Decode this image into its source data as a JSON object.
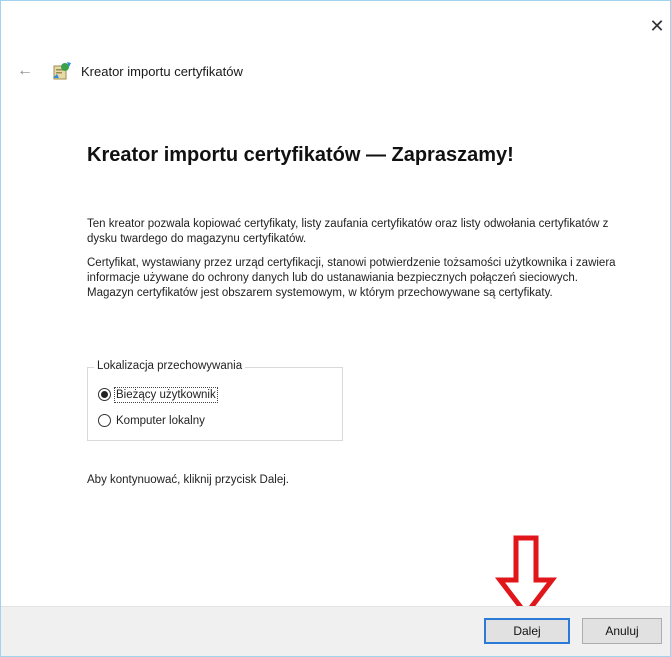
{
  "window": {
    "close_glyph": "✕"
  },
  "header": {
    "back_icon": "back-arrow-icon",
    "wizard_icon": "certificate-wizard-icon",
    "title": "Kreator importu certyfikatów"
  },
  "main": {
    "heading": "Kreator importu certyfikatów — Zapraszamy!",
    "paragraph1": "Ten kreator pozwala kopiować certyfikaty, listy zaufania certyfikatów oraz listy odwołania certyfikatów z dysku twardego do magazynu certyfikatów.",
    "paragraph2": "Certyfikat, wystawiany przez urząd certyfikacji, stanowi potwierdzenie tożsamości użytkownika i zawiera informacje używane do ochrony danych lub do ustanawiania bezpiecznych połączeń sieciowych. Magazyn certyfikatów jest obszarem systemowym, w którym przechowywane są certyfikaty.",
    "storage_group": {
      "legend": "Lokalizacja przechowywania",
      "options": [
        {
          "label": "Bieżący użytkownik",
          "checked": true
        },
        {
          "label": "Komputer lokalny",
          "checked": false
        }
      ]
    },
    "continue_text": "Aby kontynuować, kliknij przycisk Dalej."
  },
  "footer": {
    "next_label": "Dalej",
    "cancel_label": "Anuluj"
  },
  "annotation": {
    "arrow_color": "#e0161b",
    "arrow_icon": "down-arrow-annotation-icon"
  }
}
